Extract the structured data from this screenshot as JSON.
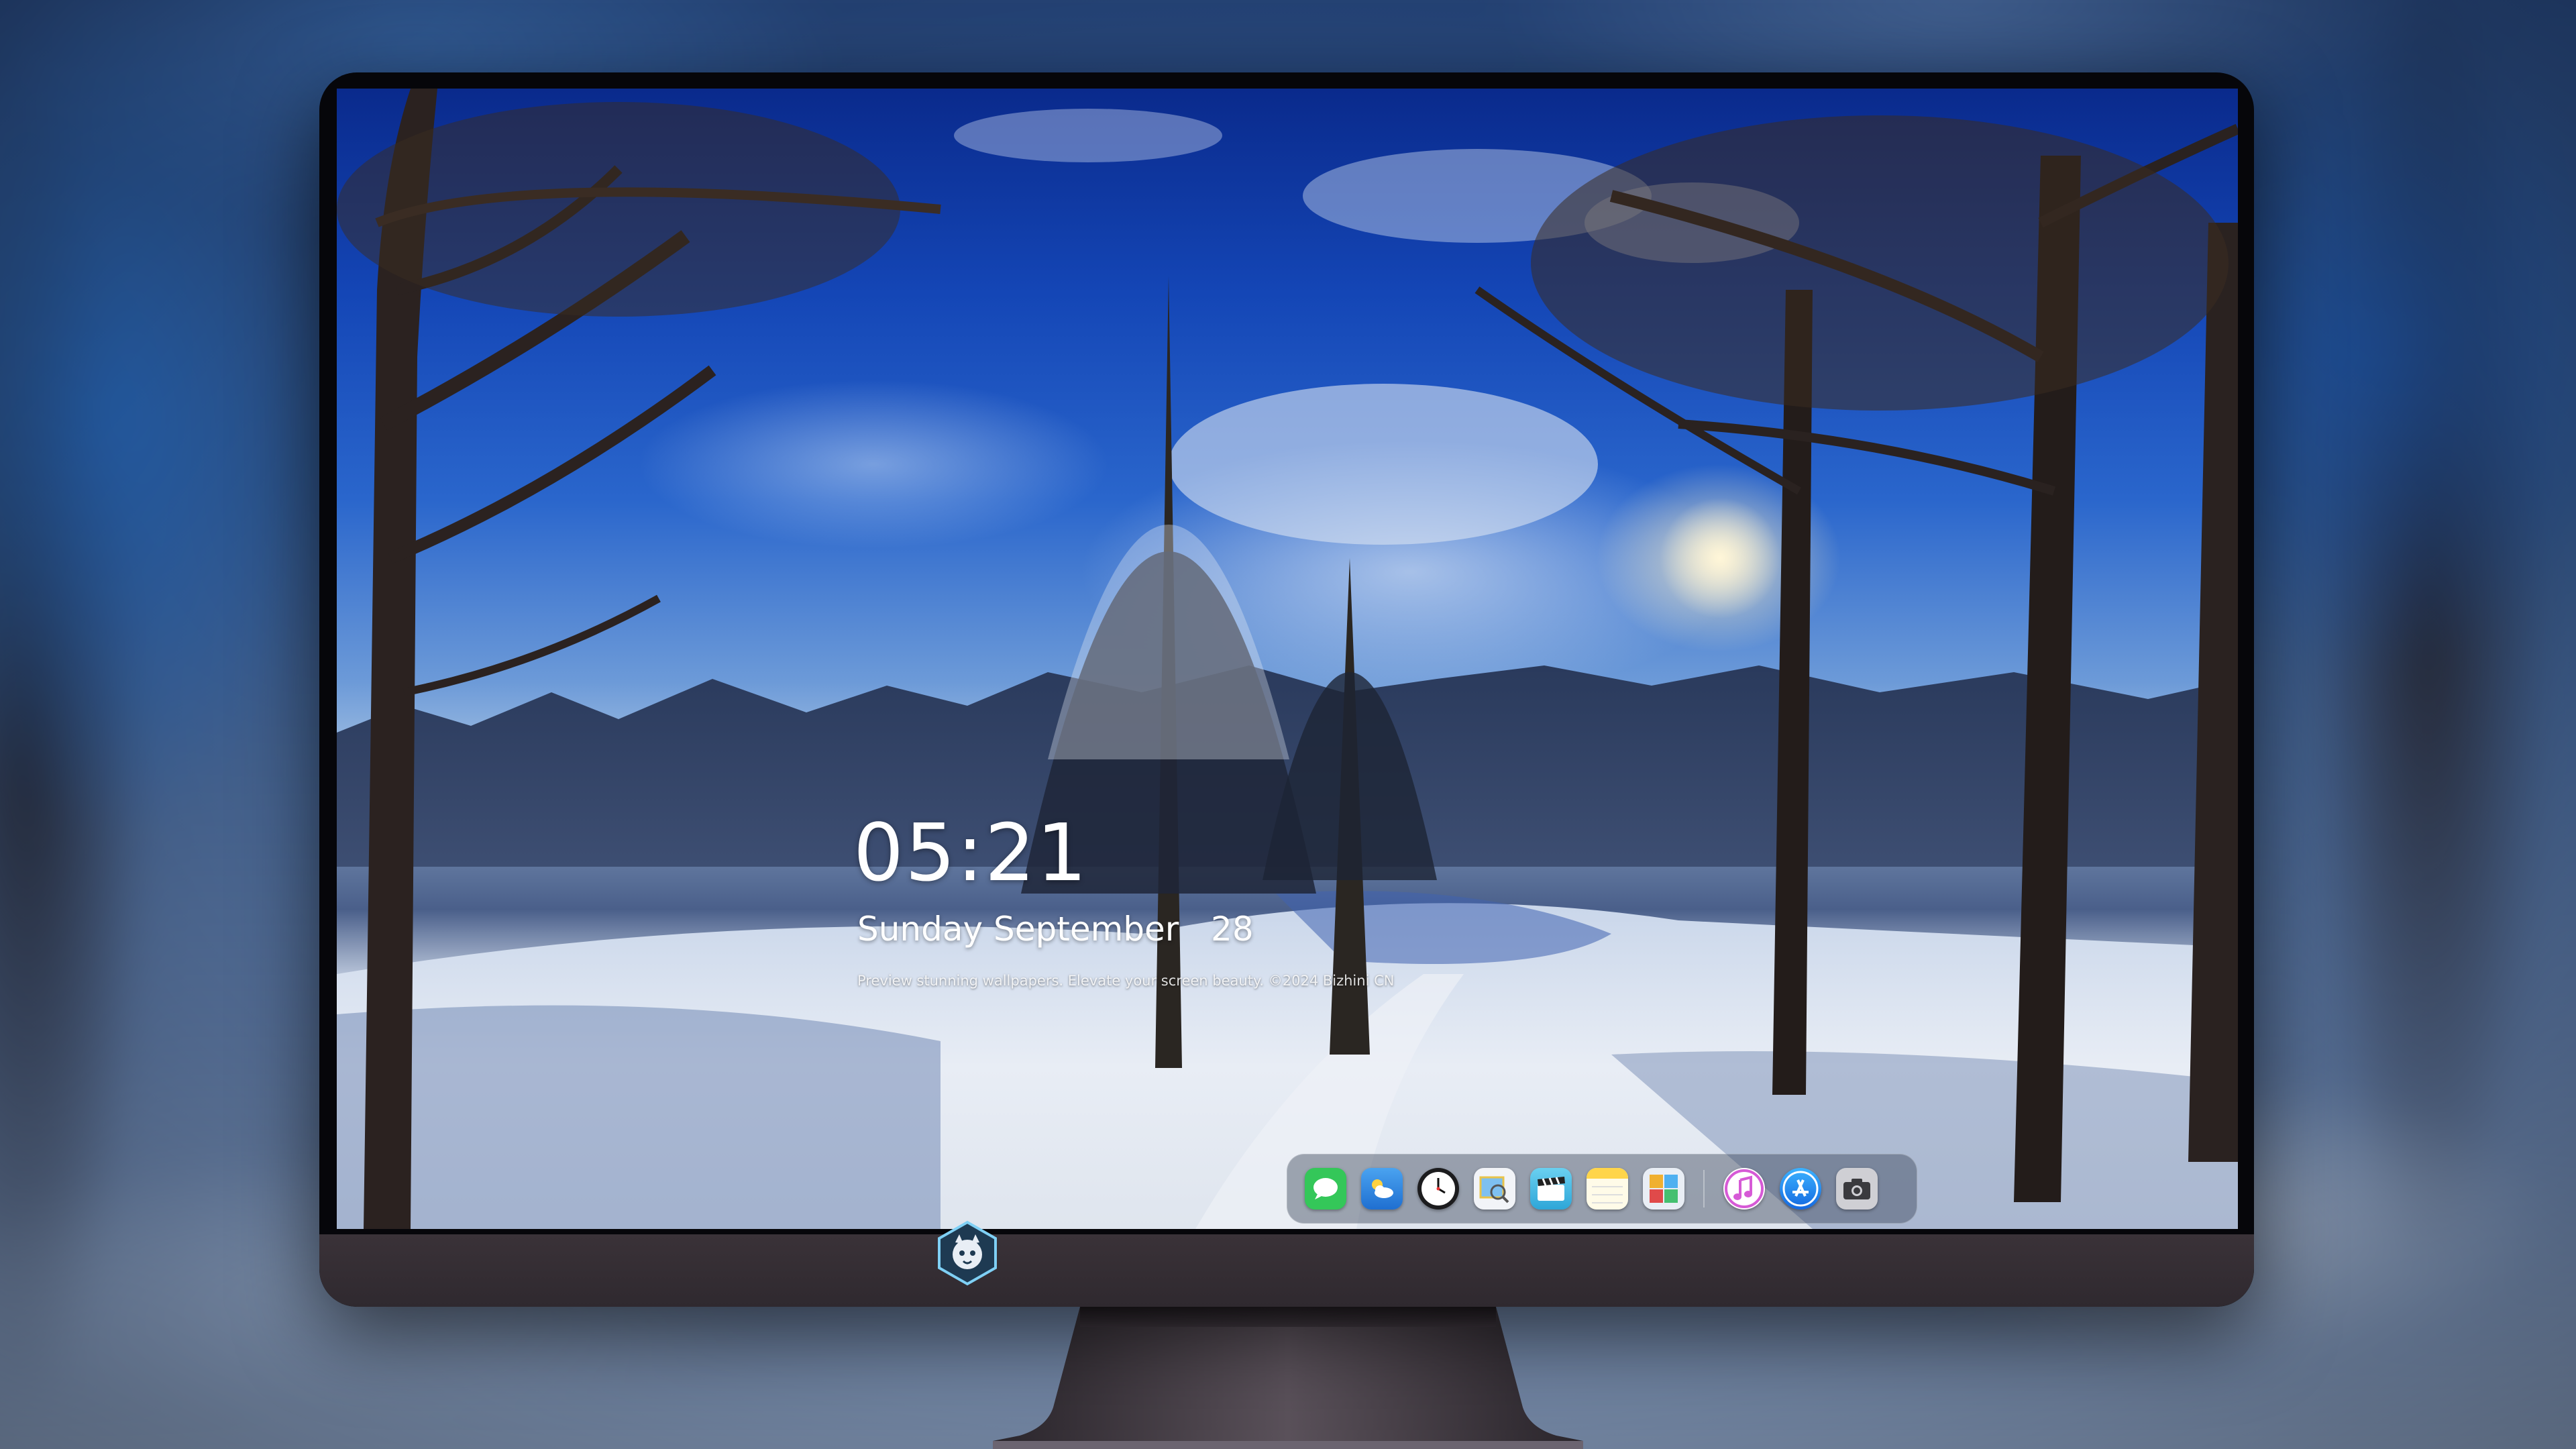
{
  "lock_screen": {
    "time": "05:21",
    "date": "Sunday September   28",
    "caption": "Preview stunning wallpapers. Elevate your screen beauty. ©2024 Bizhini CN"
  },
  "dock": {
    "apps": [
      {
        "name": "Messages",
        "icon": "messages-icon",
        "color": "#34c759"
      },
      {
        "name": "Weather",
        "icon": "weather-icon",
        "color": "#3a8ee8"
      },
      {
        "name": "Clock",
        "icon": "clock-icon",
        "color": "#ffffff"
      },
      {
        "name": "Preview",
        "icon": "preview-icon",
        "color": "#e8c34a"
      },
      {
        "name": "Clips",
        "icon": "clapperboard-icon",
        "color": "#52c3e6"
      },
      {
        "name": "Notes",
        "icon": "notes-icon",
        "color": "#ffd54a"
      },
      {
        "name": "Photo Booth",
        "icon": "photos-grid-icon",
        "color": "#e9eef5"
      },
      {
        "name": "iTunes",
        "icon": "music-note-icon",
        "color": "#d65ad6"
      },
      {
        "name": "App Store",
        "icon": "app-store-icon",
        "color": "#1f8cf0"
      },
      {
        "name": "Screenshot",
        "icon": "camera-icon",
        "color": "#6e6e73"
      }
    ]
  },
  "colors": {
    "monitor_bezel": "#06060a",
    "monitor_chin": "#3a3238",
    "text": "#ffffff"
  }
}
